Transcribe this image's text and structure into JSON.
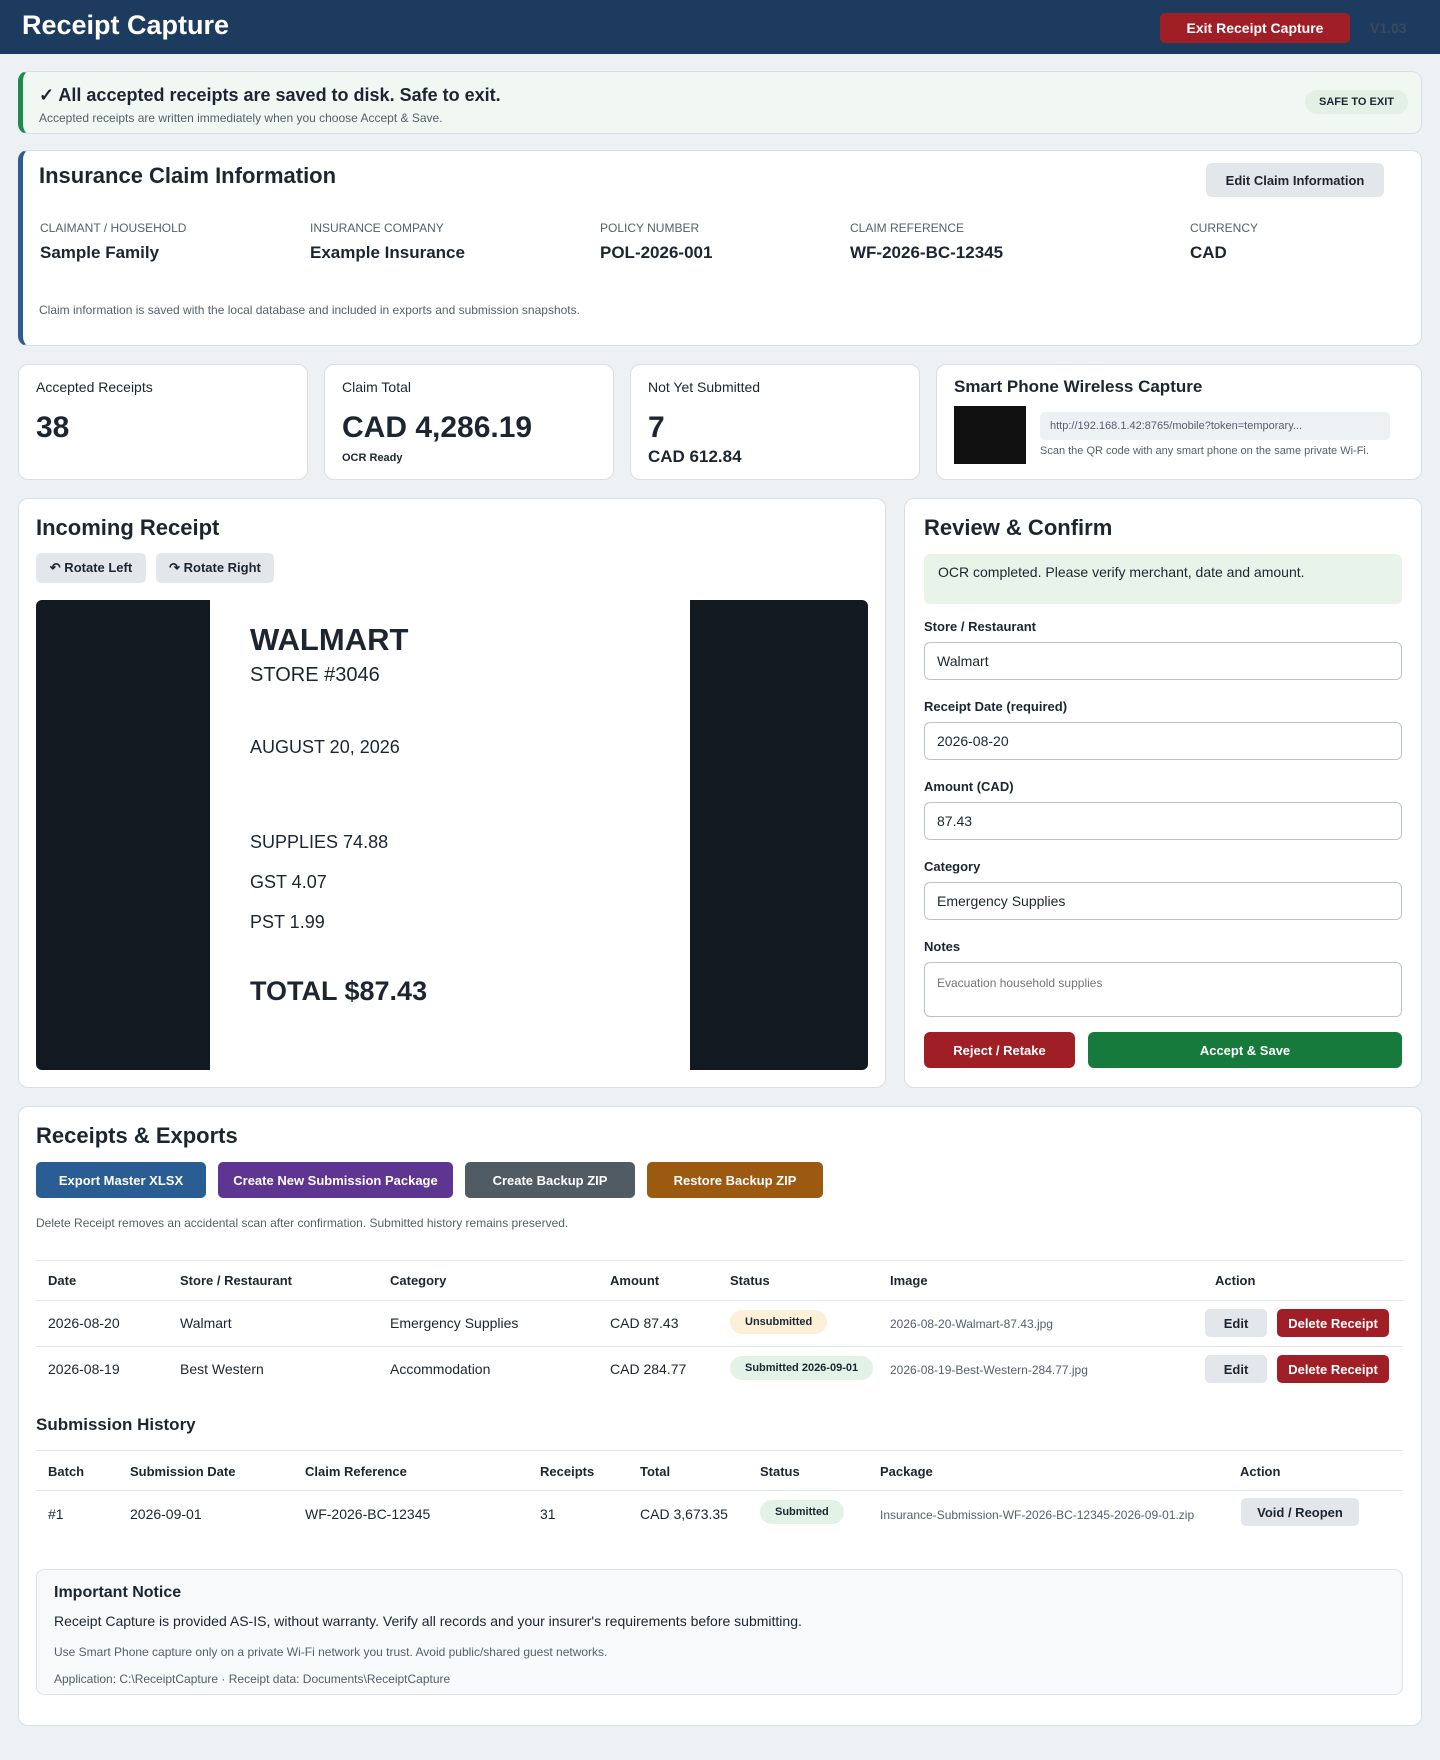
{
  "app": {
    "title": "Receipt Capture",
    "exit_label": "Exit Receipt Capture",
    "version": "V1.03"
  },
  "banner": {
    "title": "✓ All accepted receipts are saved to disk. Safe to exit.",
    "subtitle": "Accepted receipts are written immediately when you choose Accept & Save.",
    "badge": "SAFE TO EXIT"
  },
  "claim": {
    "title": "Insurance Claim Information",
    "edit_label": "Edit Claim Information",
    "fields": [
      {
        "label": "Claimant / Household",
        "value": "Sample Family"
      },
      {
        "label": "Insurance Company",
        "value": "Example Insurance"
      },
      {
        "label": "Policy Number",
        "value": "POL-2026-001"
      },
      {
        "label": "Claim Reference",
        "value": "WF-2026-BC-12345"
      },
      {
        "label": "Currency",
        "value": "CAD"
      }
    ],
    "note": "Claim information is saved with the local database and included in exports and submission snapshots."
  },
  "stats": {
    "accepted": {
      "label": "Accepted Receipts",
      "value": "38"
    },
    "total": {
      "label": "Claim Total",
      "value": "CAD 4,286.19",
      "sub": "OCR Ready"
    },
    "unsubmitted": {
      "label": "Not Yet Submitted",
      "value": "7",
      "sub": "CAD 612.84"
    },
    "phone": {
      "title": "Smart Phone Wireless Capture",
      "url": "http://192.168.1.42:8765/mobile?token=temporary...",
      "hint": "Scan the QR code with any smart phone on the same private Wi-Fi."
    }
  },
  "incoming": {
    "title": "Incoming Receipt",
    "rotate_left": "↶ Rotate Left",
    "rotate_right": "↷ Rotate Right",
    "receipt": {
      "merchant": "WALMART",
      "store": "STORE #3046",
      "date": "AUGUST 20, 2026",
      "lines": [
        "SUPPLIES 74.88",
        "GST 4.07",
        "PST 1.99"
      ],
      "total": "TOTAL $87.43"
    }
  },
  "review": {
    "title": "Review & Confirm",
    "ocr_message": "OCR completed. Please verify merchant, date and amount.",
    "store_label": "Store / Restaurant",
    "store_value": "Walmart",
    "date_label": "Receipt Date (required)",
    "date_value": "2026-08-20",
    "amount_label": "Amount (CAD)",
    "amount_value": "87.43",
    "category_label": "Category",
    "category_value": "Emergency Supplies",
    "notes_label": "Notes",
    "notes_placeholder": "Evacuation household supplies",
    "reject_label": "Reject / Retake",
    "accept_label": "Accept & Save"
  },
  "exports": {
    "title": "Receipts & Exports",
    "buttons": [
      {
        "label": "Export Master XLSX",
        "color": "#2a5d94"
      },
      {
        "label": "Create New Submission Package",
        "color": "#5e3591"
      },
      {
        "label": "Create Backup ZIP",
        "color": "#515b63"
      },
      {
        "label": "Restore Backup ZIP",
        "color": "#9c5a10"
      }
    ],
    "note": "Delete Receipt removes an accidental scan after confirmation. Submitted history remains preserved.",
    "receipt_headers": [
      "Date",
      "Store / Restaurant",
      "Category",
      "Amount",
      "Status",
      "Image",
      "Action"
    ],
    "receipts": [
      {
        "date": "2026-08-20",
        "store": "Walmart",
        "category": "Emergency Supplies",
        "amount": "CAD 87.43",
        "status": "Unsubmitted",
        "image": "2026-08-20-Walmart-87.43.jpg",
        "edit": "Edit",
        "delete": "Delete Receipt"
      },
      {
        "date": "2026-08-19",
        "store": "Best Western",
        "category": "Accommodation",
        "amount": "CAD 284.77",
        "status": "Submitted 2026-09-01",
        "image": "2026-08-19-Best-Western-284.77.jpg",
        "edit": "Edit",
        "delete": "Delete Receipt"
      }
    ],
    "history_title": "Submission History",
    "history_headers": [
      "Batch",
      "Submission Date",
      "Claim Reference",
      "Receipts",
      "Total",
      "Status",
      "Package",
      "Action"
    ],
    "history": [
      {
        "batch": "#1",
        "date": "2026-09-01",
        "reference": "WF-2026-BC-12345",
        "receipts": "31",
        "total": "CAD 3,673.35",
        "status": "Submitted",
        "package": "Insurance-Submission-WF-2026-BC-12345-2026-09-01.zip",
        "action": "Void / Reopen"
      }
    ]
  },
  "notice": {
    "title": "Important Notice",
    "text": "Receipt Capture is provided AS-IS, without warranty. Verify all records and your insurer's requirements before submitting.",
    "wifi": "Use Smart Phone capture only on a private Wi-Fi network you trust. Avoid public/shared guest networks.",
    "paths": "Application: C:\\ReceiptCapture · Receipt data: Documents\\ReceiptCapture"
  }
}
